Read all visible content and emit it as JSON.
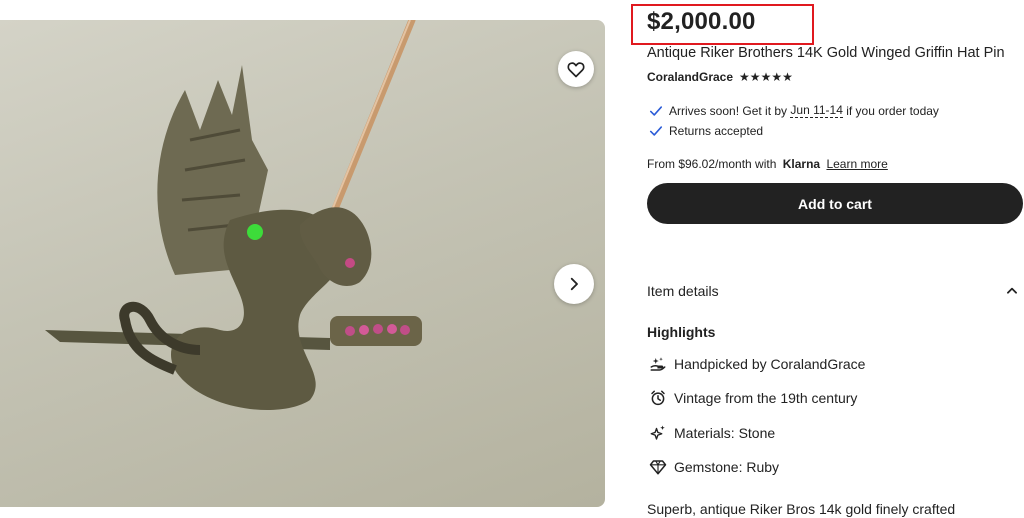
{
  "listing": {
    "price": "$2,000.00",
    "title": "Antique Riker Brothers 14K Gold Winged Griffin Hat Pin",
    "shop_name": "CoralandGrace",
    "rating_stars": "★★★★★"
  },
  "shipping": {
    "arrival_prefix": "Arrives soon! Get it by ",
    "arrival_dates": "Jun 11-14",
    "arrival_suffix": " if you order today",
    "returns": "Returns accepted"
  },
  "klarna": {
    "prefix": "From $96.02/month with",
    "brand": "Klarna",
    "link": "Learn more"
  },
  "buttons": {
    "add_to_cart": "Add to cart"
  },
  "details": {
    "header": "Item details",
    "highlights_title": "Highlights",
    "handpicked_prefix": "Handpicked by ",
    "handpicked_shop": "CoralandGrace",
    "vintage": "Vintage from the 19th century",
    "materials": "Materials: Stone",
    "gemstone": "Gemstone: Ruby",
    "description": "Superb, antique Riker Bros 14k gold finely crafted"
  },
  "icons": {
    "favorite": "heart-icon",
    "next": "chevron-right-icon",
    "check": "check-icon",
    "collapse": "chevron-up-icon",
    "handpicked": "hand-sparkle-icon",
    "vintage": "alarm-clock-icon",
    "materials": "sparkle-icon",
    "gemstone": "diamond-icon"
  },
  "colors": {
    "highlight_border": "#e0191f",
    "check": "#2a5bd7",
    "button": "#222222"
  }
}
